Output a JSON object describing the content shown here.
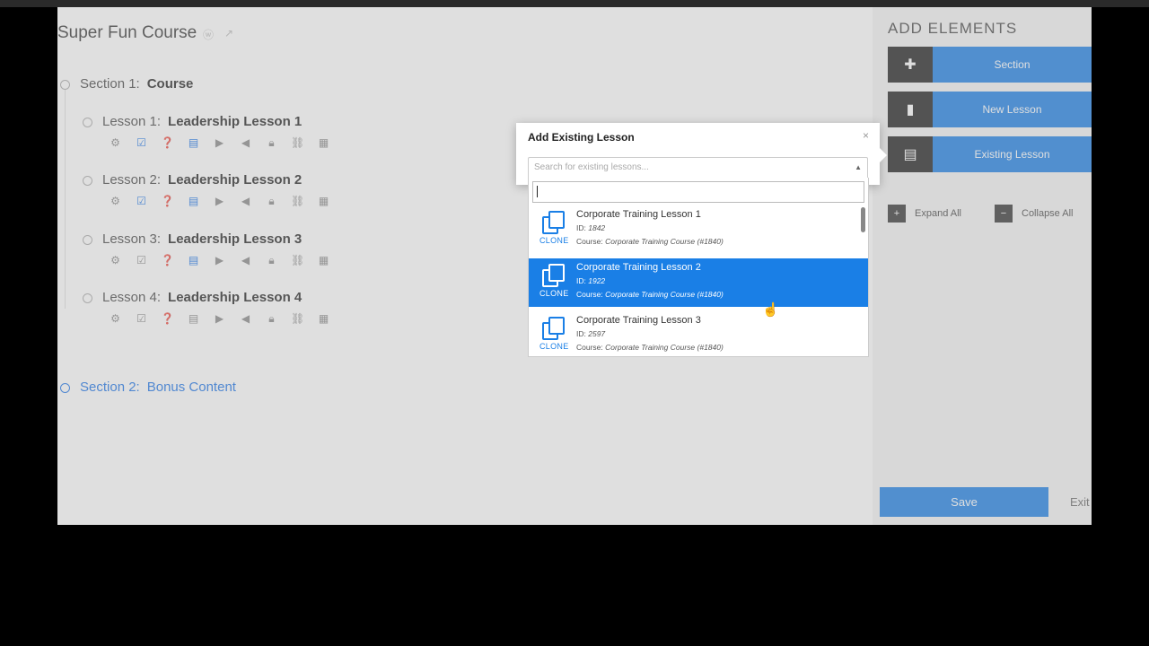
{
  "course": {
    "title": "Super Fun Course",
    "sections": [
      {
        "prefix": "Section 1:",
        "name": "Course",
        "lessons": [
          {
            "prefix": "Lesson 1:",
            "name": "Leadership Lesson 1"
          },
          {
            "prefix": "Lesson 2:",
            "name": "Leadership Lesson 2"
          },
          {
            "prefix": "Lesson 3:",
            "name": "Leadership Lesson 3"
          },
          {
            "prefix": "Lesson 4:",
            "name": "Leadership Lesson 4"
          }
        ]
      },
      {
        "prefix": "Section 2:",
        "name": "Bonus Content",
        "lessons": []
      }
    ]
  },
  "sidebar": {
    "title": "ADD ELEMENTS",
    "buttons": [
      {
        "label": "Section",
        "icon": "puzzle-icon"
      },
      {
        "label": "New Lesson",
        "icon": "document-icon"
      },
      {
        "label": "Existing Lesson",
        "icon": "document-text-icon"
      }
    ],
    "expand_all": "Expand All",
    "collapse_all": "Collapse All",
    "save": "Save",
    "exit": "Exit"
  },
  "modal": {
    "title": "Add Existing Lesson",
    "close": "×",
    "select_placeholder": "Search for existing lessons...",
    "search_value": "",
    "options": [
      {
        "title": "Corporate Training Lesson 1",
        "id_label": "ID:",
        "id": "1842",
        "course_label": "Course:",
        "course": "Corporate Training Course",
        "course_id": "(#1840)",
        "clone": "CLONE",
        "highlighted": false
      },
      {
        "title": "Corporate Training Lesson 2",
        "id_label": "ID:",
        "id": "1922",
        "course_label": "Course:",
        "course": "Corporate Training Course",
        "course_id": "(#1840)",
        "clone": "CLONE",
        "highlighted": true
      },
      {
        "title": "Corporate Training Lesson 3",
        "id_label": "ID:",
        "id": "2597",
        "course_label": "Course:",
        "course": "Corporate Training Course",
        "course_id": "(#1840)",
        "clone": "CLONE",
        "highlighted": false
      }
    ]
  },
  "colors": {
    "accent": "#1a7fe6",
    "dark": "#1e1e1e"
  }
}
